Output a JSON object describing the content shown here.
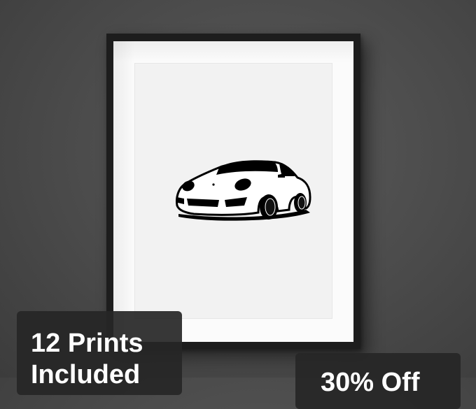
{
  "badges": {
    "prints_line1": "12 Prints",
    "prints_line2": "Included",
    "discount": "30% Off"
  },
  "colors": {
    "wall": "#4a4a4a",
    "frame": "#1d1d1d",
    "mat": "#fbfbfb",
    "badge_background": "#262626",
    "badge_text": "#ffffff"
  },
  "artwork": {
    "subject": "sports-car-silhouette-icon"
  }
}
